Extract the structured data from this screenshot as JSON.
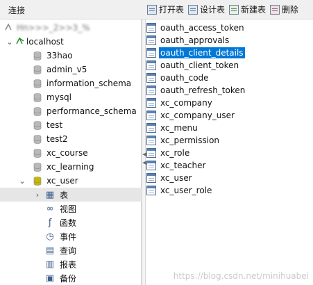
{
  "left_panel": {
    "title": "连接",
    "connection_redacted": "Hn>>>_2>>3_%",
    "server": "localhost",
    "databases": [
      "33hao",
      "admin_v5",
      "information_schema",
      "mysql",
      "performance_schema",
      "test",
      "test2",
      "xc_course",
      "xc_learning",
      "xc_user"
    ],
    "children": [
      {
        "label": "表",
        "icon": "table-group-icon"
      },
      {
        "label": "视图",
        "icon": "view-icon"
      },
      {
        "label": "函数",
        "icon": "function-icon"
      },
      {
        "label": "事件",
        "icon": "event-icon"
      },
      {
        "label": "查询",
        "icon": "query-icon"
      },
      {
        "label": "报表",
        "icon": "report-icon"
      },
      {
        "label": "备份",
        "icon": "backup-icon"
      }
    ]
  },
  "toolbar": {
    "open_label": "打开表",
    "design_label": "设计表",
    "new_label": "新建表",
    "delete_label": "删除"
  },
  "tables": [
    "oauth_access_token",
    "oauth_approvals",
    "oauth_client_details",
    "oauth_client_token",
    "oauth_code",
    "oauth_refresh_token",
    "xc_company",
    "xc_company_user",
    "xc_menu",
    "xc_permission",
    "xc_role",
    "xc_teacher",
    "xc_user",
    "xc_user_role"
  ],
  "selected_table": "oauth_client_details",
  "watermark": "https://blog.csdn.net/minihuabei",
  "colors": {
    "selection": "#0078d7",
    "tree_selected": "#e6e6e6",
    "db_icon": "#b9b9b9",
    "active_db_icon": "#c8b800"
  }
}
